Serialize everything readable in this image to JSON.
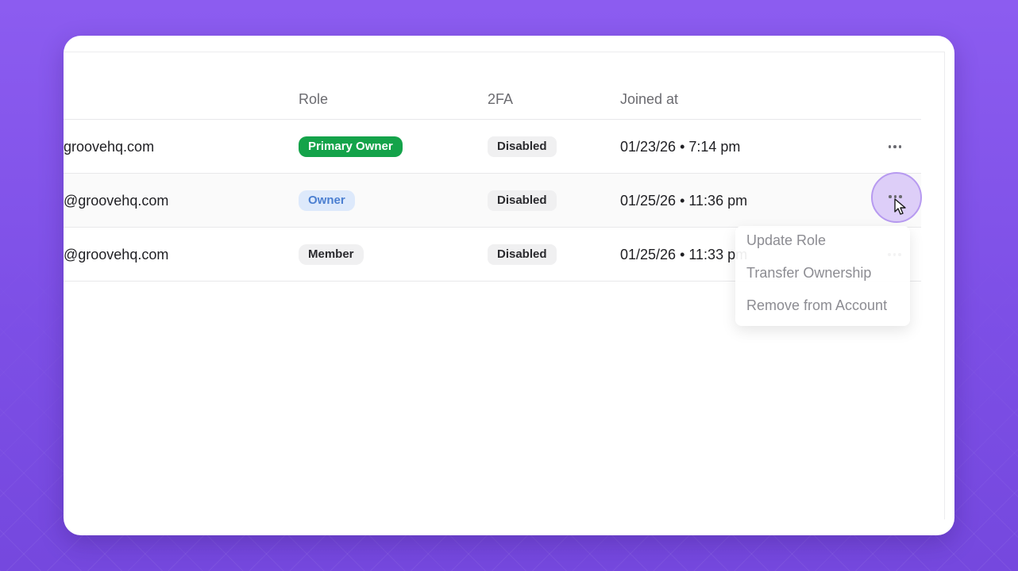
{
  "table": {
    "headers": {
      "role": "Role",
      "tfa": "2FA",
      "joined": "Joined at"
    },
    "rows": [
      {
        "email": "groovehq.com",
        "role": "Primary Owner",
        "role_style": "primary",
        "tfa": "Disabled",
        "joined": "01/23/26 • 7:14 pm"
      },
      {
        "email": "@groovehq.com",
        "role": "Owner",
        "role_style": "owner",
        "tfa": "Disabled",
        "joined": "01/25/26 • 11:36 pm"
      },
      {
        "email": "@groovehq.com",
        "role": "Member",
        "role_style": "member",
        "tfa": "Disabled",
        "joined": "01/25/26 • 11:33 pm"
      }
    ]
  },
  "menu": {
    "items": [
      "Update Role",
      "Transfer Ownership",
      "Remove from Account"
    ]
  },
  "icons": {
    "more": "more-horizontal-icon",
    "cursor": "pointer-cursor-icon"
  },
  "colors": {
    "background": "#8c5cf0",
    "primary_badge": "#14a34a",
    "owner_badge_bg": "#dde9fb",
    "owner_badge_text": "#4b7fd1",
    "highlight": "#b79af0"
  }
}
